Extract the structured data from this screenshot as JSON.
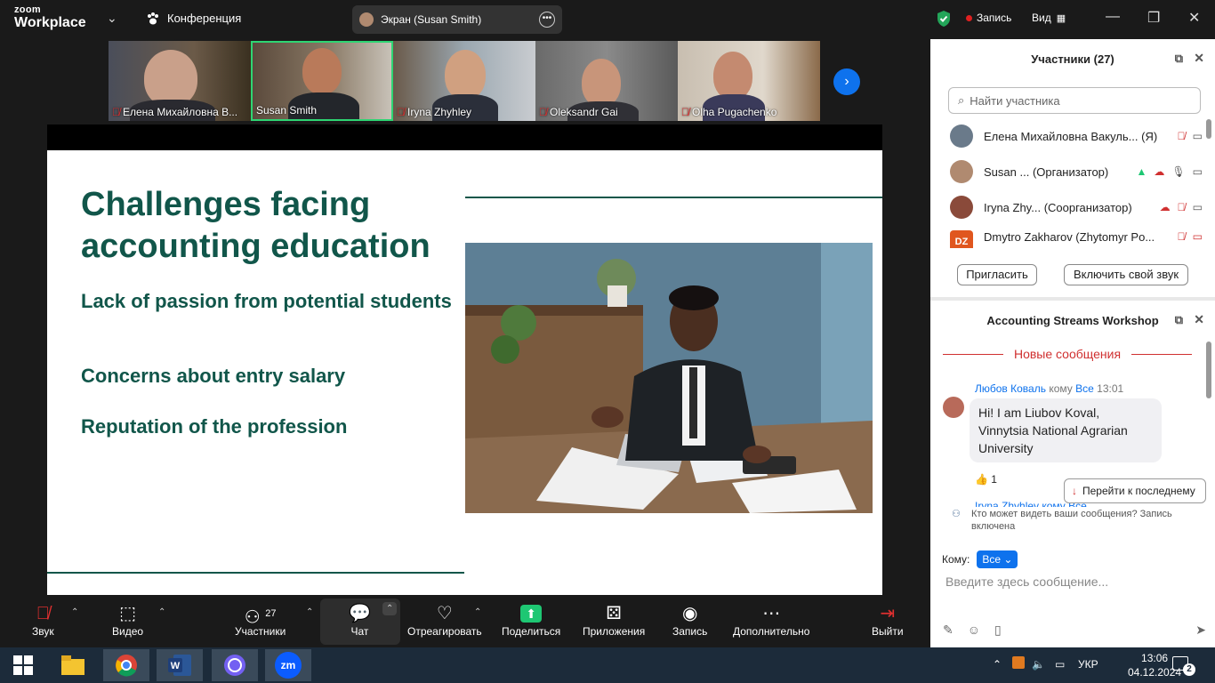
{
  "titlebar": {
    "logo_top": "zoom",
    "logo_bottom": "Workplace",
    "meeting_label": "Конференция",
    "screen_pill": "Экран (Susan Smith)",
    "record_label": "Запись",
    "view_label": "Вид"
  },
  "video_strip": {
    "tiles": [
      {
        "name": "Елена Михайловна В...",
        "muted": true
      },
      {
        "name": "Susan Smith",
        "muted": false
      },
      {
        "name": "Iryna Zhyhley",
        "muted": true
      },
      {
        "name": "Oleksandr Gai",
        "muted": true
      },
      {
        "name": "Olha Pugachenko",
        "muted": true
      }
    ]
  },
  "slide": {
    "title": "Challenges facing accounting education",
    "bullets": [
      "Lack of passion from potential students",
      "Concerns about entry salary",
      "Reputation of the profession"
    ]
  },
  "participants": {
    "header": "Участники (27)",
    "search_placeholder": "Найти участника",
    "rows": [
      {
        "name": "Елена Михайловна Вакуль...",
        "role": "(Я)",
        "avatar_color": "#6a7a8a"
      },
      {
        "name": "Susan ...",
        "role": "(Организатор)",
        "avatar_color": "#b08a70"
      },
      {
        "name": "Iryna Zhy...",
        "role": "(Соорганизатор)",
        "avatar_color": "#8a4a3a"
      },
      {
        "name": "Dmytro Zakharov (Zhytomyr Po...",
        "role": "",
        "avatar_color": "#e0561e",
        "initials": "DZ"
      }
    ],
    "invite_button": "Пригласить",
    "unmute_button": "Включить свой звук"
  },
  "chat": {
    "header": "Accounting Streams Workshop",
    "new_messages": "Новые сообщения",
    "message": {
      "author": "Любов Коваль",
      "to_word": "кому",
      "to": "Все",
      "time": "13:01",
      "text": "Hi! I am Liubov Koval, Vinnytsia National Agrarian University",
      "reaction": "👍 1"
    },
    "jump_button": "Перейти к последнему",
    "next_author": "Iryna Zhyhley кому Все",
    "privacy_note": "Кто может видеть ваши сообщения? Запись включена",
    "to_label": "Кому:",
    "to_value": "Все",
    "compose_placeholder": "Введите здесь сообщение..."
  },
  "toolbar": {
    "audio": "Звук",
    "video": "Видео",
    "participants": "Участники",
    "participants_count": "27",
    "chat": "Чат",
    "react": "Отреагировать",
    "share": "Поделиться",
    "apps": "Приложения",
    "record": "Запись",
    "more": "Дополнительно",
    "leave": "Выйти"
  },
  "taskbar": {
    "lang": "УКР",
    "time": "13:06",
    "date": "04.12.2024",
    "notifications": "2",
    "zoom_label": "zm"
  },
  "colors": {
    "accent": "#0e72ed",
    "slide_green": "#11564a",
    "record_red": "#e02020",
    "share_green": "#1ec773",
    "active_speaker": "#2ed573"
  }
}
